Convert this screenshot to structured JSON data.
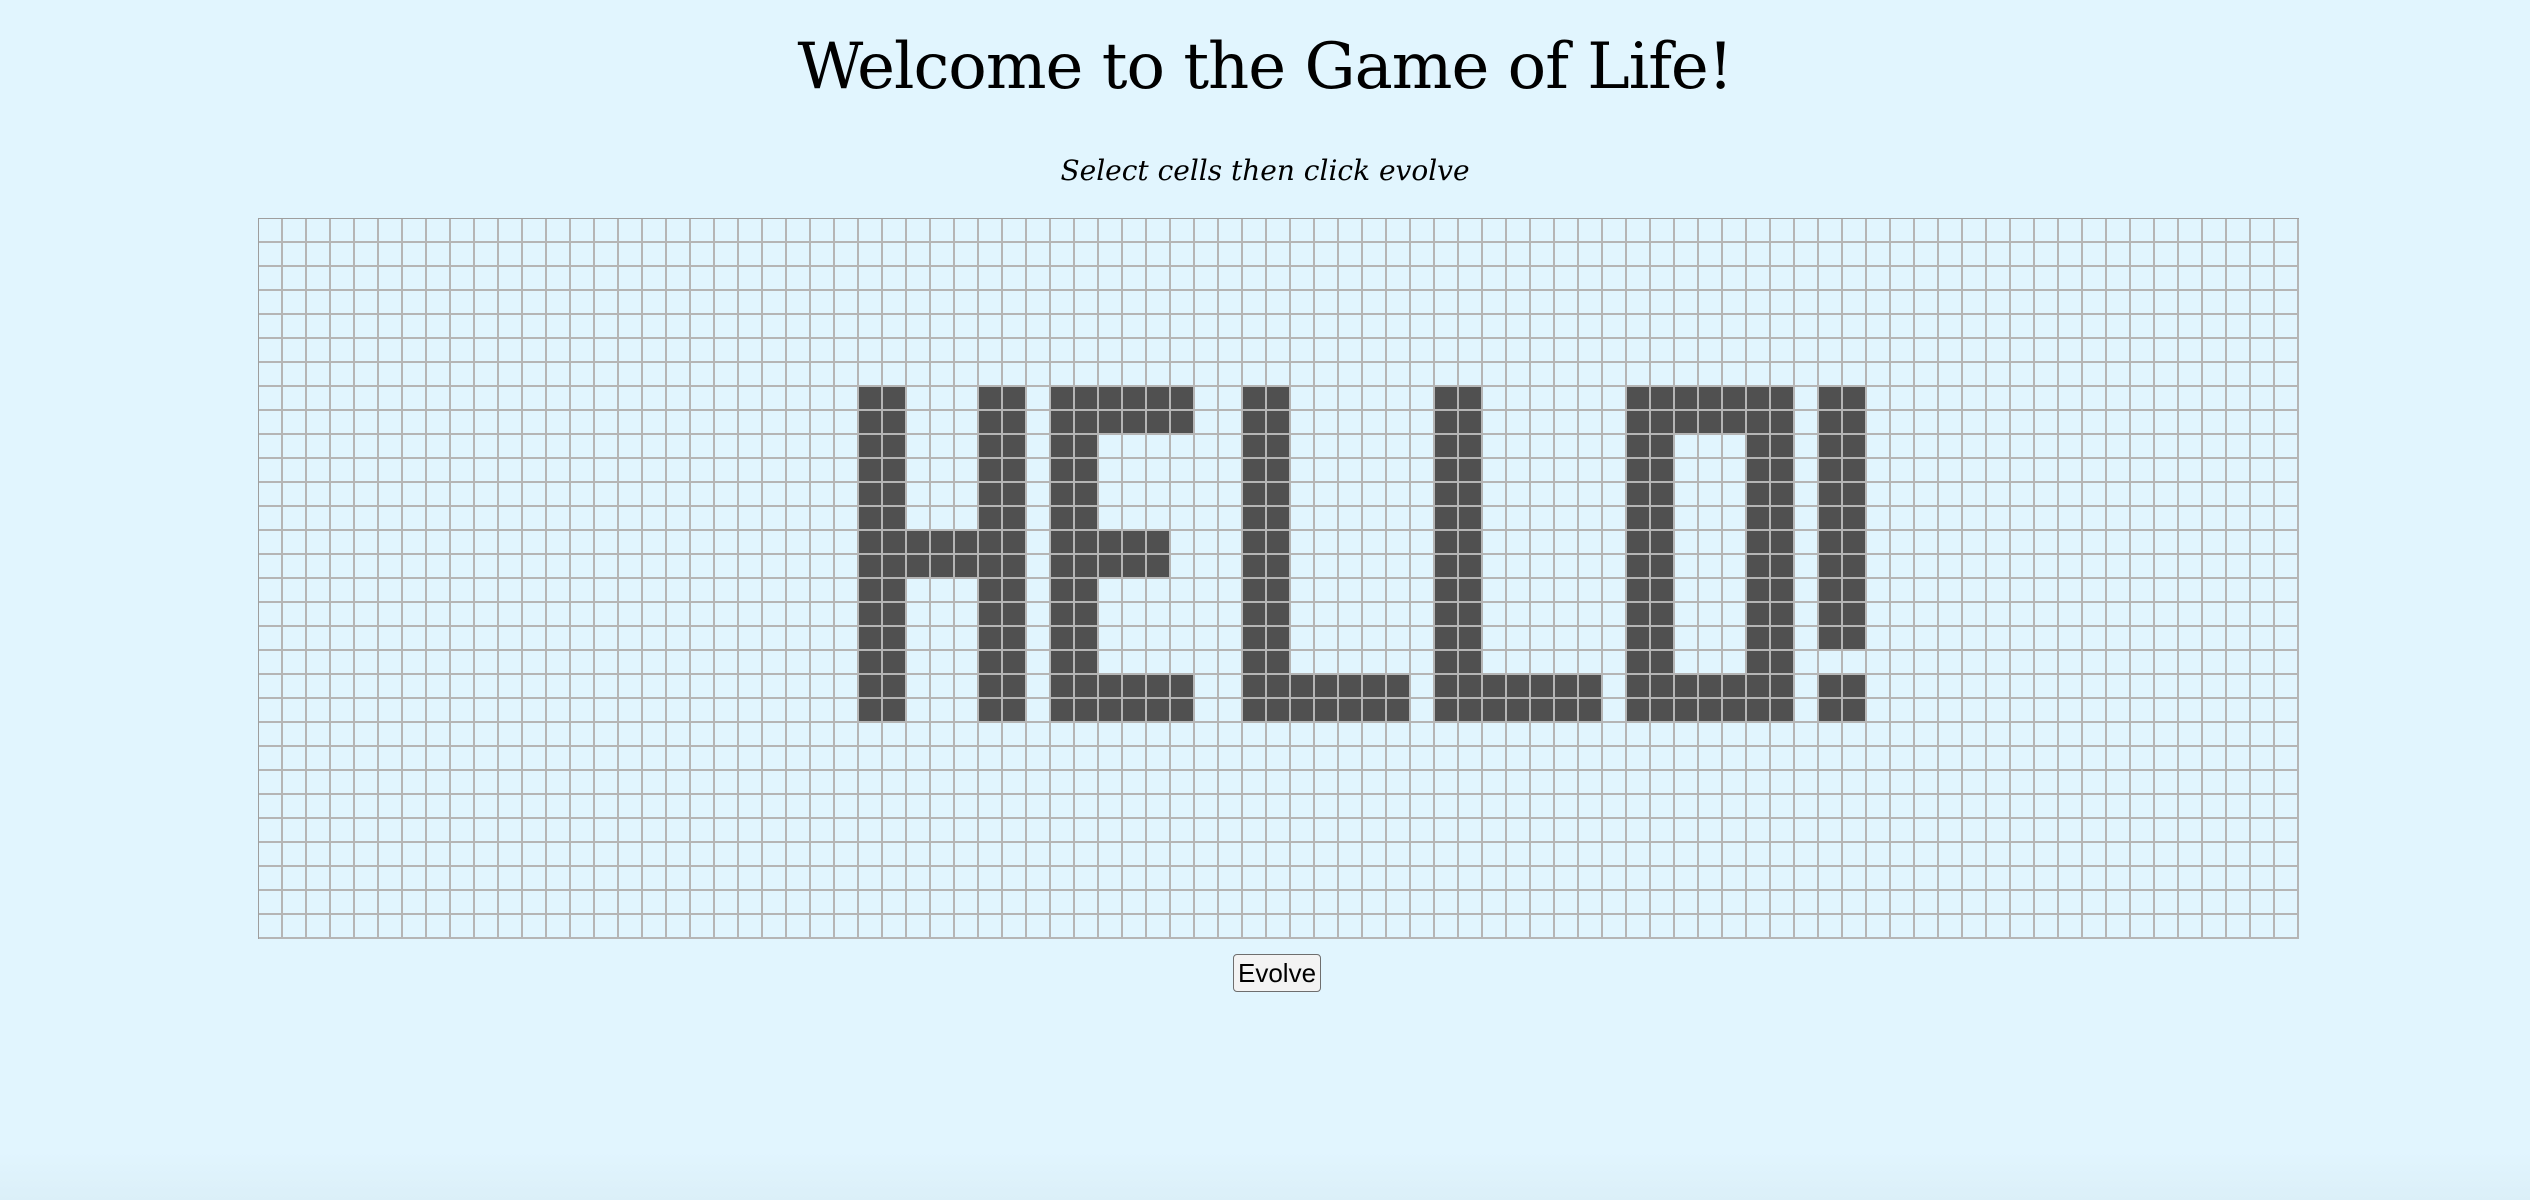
{
  "title": "Welcome to the Game of Life!",
  "subtitle": "Select cells then click evolve",
  "evolve_button_label": "Evolve",
  "grid": {
    "rows": 30,
    "cols": 85,
    "alive_color": "#505050",
    "dead_color": "#e1f5fe",
    "line_color": "#b5b5b5",
    "alive_row_ranges": [
      [
        7,
        25,
        26
      ],
      [
        7,
        30,
        31
      ],
      [
        7,
        33,
        38
      ],
      [
        7,
        41,
        42
      ],
      [
        7,
        49,
        50
      ],
      [
        7,
        57,
        63
      ],
      [
        7,
        65,
        66
      ],
      [
        8,
        25,
        26
      ],
      [
        8,
        30,
        31
      ],
      [
        8,
        33,
        38
      ],
      [
        8,
        41,
        42
      ],
      [
        8,
        49,
        50
      ],
      [
        8,
        57,
        63
      ],
      [
        8,
        65,
        66
      ],
      [
        9,
        25,
        26
      ],
      [
        9,
        30,
        31
      ],
      [
        9,
        33,
        34
      ],
      [
        9,
        41,
        42
      ],
      [
        9,
        49,
        50
      ],
      [
        9,
        57,
        58
      ],
      [
        9,
        62,
        63
      ],
      [
        9,
        65,
        66
      ],
      [
        10,
        25,
        26
      ],
      [
        10,
        30,
        31
      ],
      [
        10,
        33,
        34
      ],
      [
        10,
        41,
        42
      ],
      [
        10,
        49,
        50
      ],
      [
        10,
        57,
        58
      ],
      [
        10,
        62,
        63
      ],
      [
        10,
        65,
        66
      ],
      [
        11,
        25,
        26
      ],
      [
        11,
        30,
        31
      ],
      [
        11,
        33,
        34
      ],
      [
        11,
        41,
        42
      ],
      [
        11,
        49,
        50
      ],
      [
        11,
        57,
        58
      ],
      [
        11,
        62,
        63
      ],
      [
        11,
        65,
        66
      ],
      [
        12,
        25,
        26
      ],
      [
        12,
        30,
        31
      ],
      [
        12,
        33,
        34
      ],
      [
        12,
        41,
        42
      ],
      [
        12,
        49,
        50
      ],
      [
        12,
        57,
        58
      ],
      [
        12,
        62,
        63
      ],
      [
        12,
        65,
        66
      ],
      [
        13,
        25,
        31
      ],
      [
        13,
        33,
        37
      ],
      [
        13,
        41,
        42
      ],
      [
        13,
        49,
        50
      ],
      [
        13,
        57,
        58
      ],
      [
        13,
        62,
        63
      ],
      [
        13,
        65,
        66
      ],
      [
        14,
        25,
        31
      ],
      [
        14,
        33,
        37
      ],
      [
        14,
        41,
        42
      ],
      [
        14,
        49,
        50
      ],
      [
        14,
        57,
        58
      ],
      [
        14,
        62,
        63
      ],
      [
        14,
        65,
        66
      ],
      [
        15,
        25,
        26
      ],
      [
        15,
        30,
        31
      ],
      [
        15,
        33,
        34
      ],
      [
        15,
        41,
        42
      ],
      [
        15,
        49,
        50
      ],
      [
        15,
        57,
        58
      ],
      [
        15,
        62,
        63
      ],
      [
        15,
        65,
        66
      ],
      [
        16,
        25,
        26
      ],
      [
        16,
        30,
        31
      ],
      [
        16,
        33,
        34
      ],
      [
        16,
        41,
        42
      ],
      [
        16,
        49,
        50
      ],
      [
        16,
        57,
        58
      ],
      [
        16,
        62,
        63
      ],
      [
        16,
        65,
        66
      ],
      [
        17,
        25,
        26
      ],
      [
        17,
        30,
        31
      ],
      [
        17,
        33,
        34
      ],
      [
        17,
        41,
        42
      ],
      [
        17,
        49,
        50
      ],
      [
        17,
        57,
        58
      ],
      [
        17,
        62,
        63
      ],
      [
        17,
        65,
        66
      ],
      [
        18,
        25,
        26
      ],
      [
        18,
        30,
        31
      ],
      [
        18,
        33,
        34
      ],
      [
        18,
        41,
        42
      ],
      [
        18,
        49,
        50
      ],
      [
        18,
        57,
        58
      ],
      [
        18,
        62,
        63
      ],
      [
        19,
        25,
        26
      ],
      [
        19,
        30,
        31
      ],
      [
        19,
        33,
        38
      ],
      [
        19,
        41,
        47
      ],
      [
        19,
        49,
        55
      ],
      [
        19,
        57,
        63
      ],
      [
        19,
        65,
        66
      ],
      [
        20,
        25,
        26
      ],
      [
        20,
        30,
        31
      ],
      [
        20,
        33,
        38
      ],
      [
        20,
        41,
        47
      ],
      [
        20,
        49,
        55
      ],
      [
        20,
        57,
        63
      ],
      [
        20,
        65,
        66
      ]
    ]
  }
}
